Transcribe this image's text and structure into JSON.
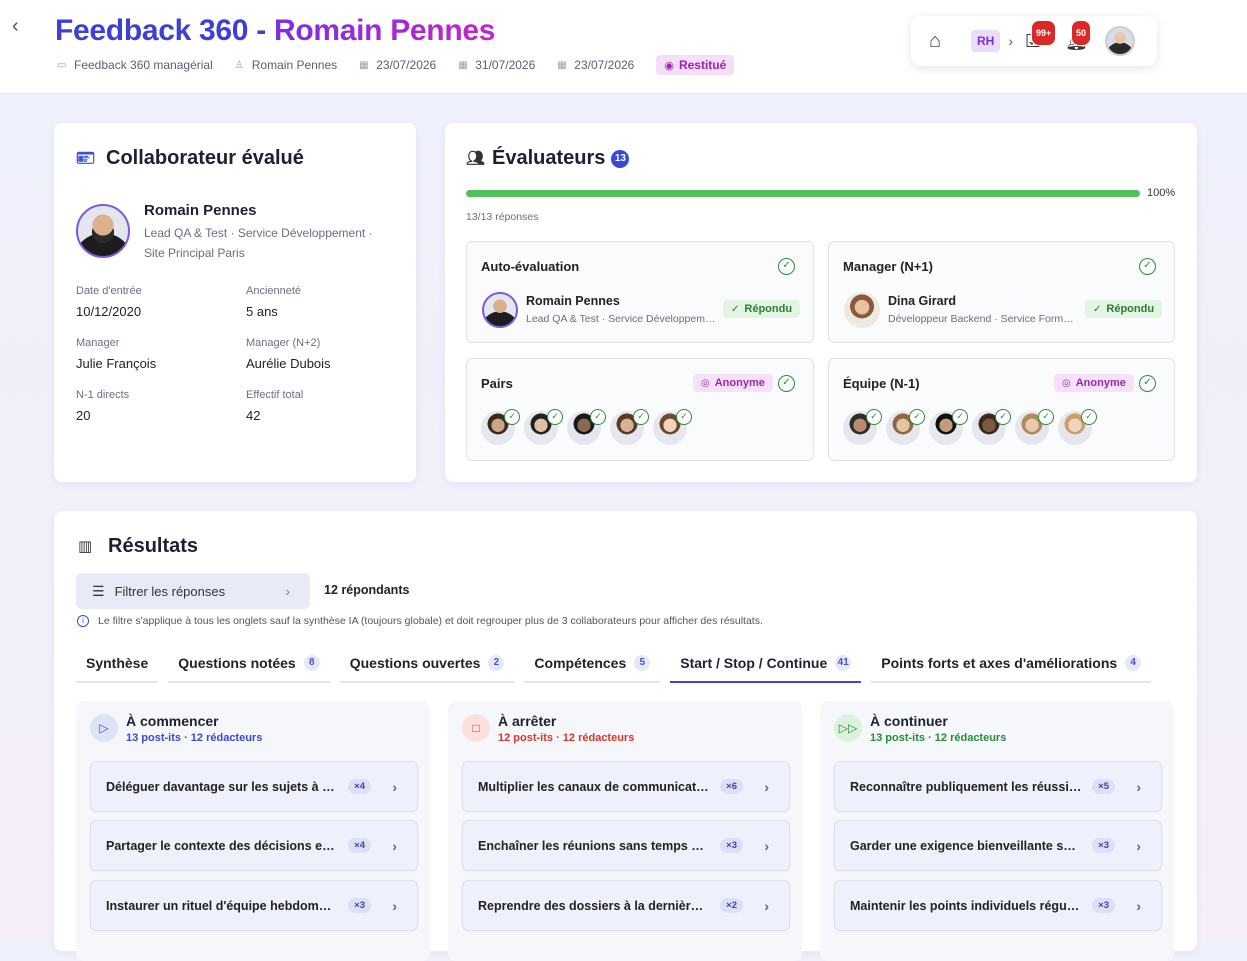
{
  "header": {
    "title_part1": "Feedback 360 -",
    "title_part2": "Romain Pennes",
    "meta": [
      {
        "icon": "doc-icon",
        "label": "Feedback 360 managérial"
      },
      {
        "icon": "user-icon",
        "label": "Romain Pennes"
      },
      {
        "icon": "calendar-icon",
        "label": "23/07/2026"
      },
      {
        "icon": "calendar-icon",
        "label": "31/07/2026"
      },
      {
        "icon": "calendar-icon",
        "label": "23/07/2026"
      }
    ],
    "status": "Restitué"
  },
  "nav": {
    "role": "RH",
    "tasks_count": "99+",
    "notifications_count": "50"
  },
  "collaborateur": {
    "section_title": "Collaborateur évalué",
    "name": "Romain Pennes",
    "role_line1": "Lead QA & Test · Service Développement ·",
    "role_line2": "Site Principal Paris",
    "fields": [
      {
        "label": "Date d'entrée",
        "value": "10/12/2020"
      },
      {
        "label": "Ancienneté",
        "value": "5 ans"
      },
      {
        "label": "Manager",
        "value": "Julie François"
      },
      {
        "label": "Manager (N+2)",
        "value": "Aurélie Dubois"
      },
      {
        "label": "N-1 directs",
        "value": "20"
      },
      {
        "label": "Effectif total",
        "value": "42"
      }
    ]
  },
  "evaluateurs": {
    "section_title": "Évaluateurs",
    "count": "13",
    "progress_percent": 100,
    "progress_label": "100%",
    "responses": "13/13 réponses",
    "auto": {
      "title": "Auto-évaluation",
      "name": "Romain Pennes",
      "role": "Lead QA & Test · Service Développem…",
      "status": "Répondu"
    },
    "manager": {
      "title": "Manager (N+1)",
      "name": "Dina Girard",
      "role": "Développeur Backend · Service Form…",
      "status": "Répondu"
    },
    "pairs": {
      "title": "Pairs",
      "tag": "Anonyme",
      "count": 5
    },
    "equipe": {
      "title": "Équipe (N-1)",
      "tag": "Anonyme",
      "count": 6
    }
  },
  "resultats": {
    "section_title": "Résultats",
    "filter_label": "Filtrer les réponses",
    "respondants": "12 répondants",
    "info": "Le filtre s'applique à tous les onglets sauf la synthèse IA (toujours globale) et doit regrouper plus de 3 collaborateurs pour afficher des résultats.",
    "tabs": [
      {
        "label": "Synthèse",
        "count": ""
      },
      {
        "label": "Questions notées",
        "count": "8"
      },
      {
        "label": "Questions ouvertes",
        "count": "2"
      },
      {
        "label": "Compétences",
        "count": "5"
      },
      {
        "label": "Start / Stop / Continue",
        "count": "41"
      },
      {
        "label": "Points forts et axes d'améliorations",
        "count": "4"
      }
    ],
    "active_tab": "Start / Stop / Continue",
    "columns": [
      {
        "title": "À commencer",
        "subtitle": "13 post-its · 12 rédacteurs",
        "color": "#3a48d8",
        "items": [
          {
            "text": "Déléguer davantage sur les sujets à fai…",
            "count": "×4"
          },
          {
            "text": "Partager le contexte des décisions en a…",
            "count": "×4"
          },
          {
            "text": "Instaurer un rituel d'équipe hebdomad…",
            "count": "×3"
          }
        ]
      },
      {
        "title": "À arrêter",
        "subtitle": "12 post-its · 12 rédacteurs",
        "color": "#d23a2a",
        "items": [
          {
            "text": "Multiplier les canaux de communicatio…",
            "count": "×6"
          },
          {
            "text": "Enchaîner les réunions sans temps de s…",
            "count": "×3"
          },
          {
            "text": "Reprendre des dossiers à la dernière m…",
            "count": "×2"
          }
        ]
      },
      {
        "title": "À continuer",
        "subtitle": "13 post-its · 12 rédacteurs",
        "color": "#2a8a36",
        "items": [
          {
            "text": "Reconnaître publiquement les réussite…",
            "count": "×5"
          },
          {
            "text": "Garder une exigence bienveillante sur l…",
            "count": "×3"
          },
          {
            "text": "Maintenir les points individuels réguliers",
            "count": "×3"
          }
        ]
      }
    ]
  }
}
